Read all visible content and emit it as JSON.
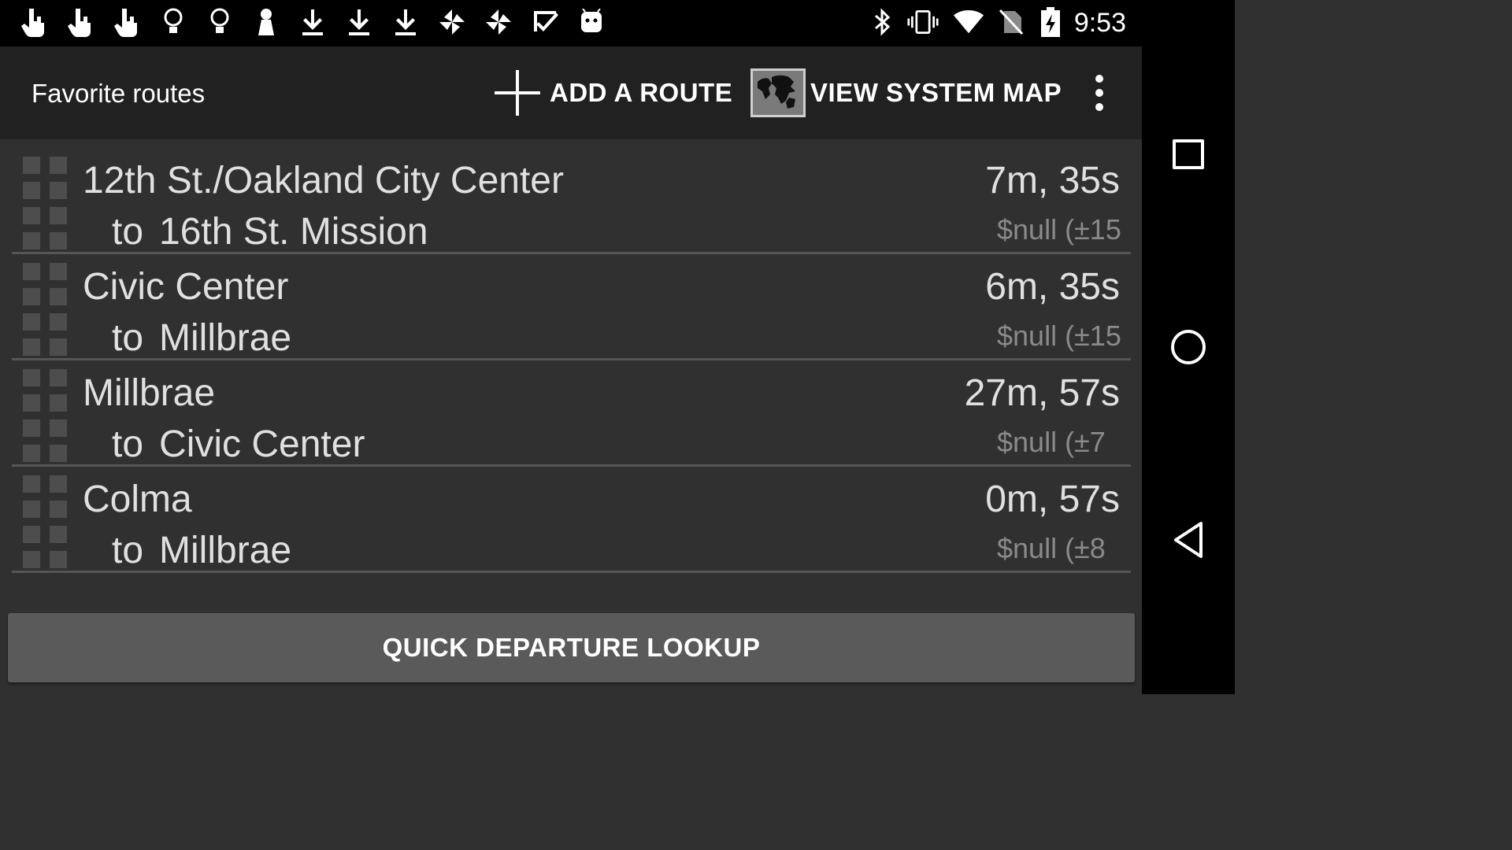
{
  "status_bar": {
    "notification_icons": [
      "hand-pointer-icon",
      "hand-pointer-icon",
      "hand-pointer-icon",
      "lightbulb-icon",
      "lightbulb-icon",
      "chess-pawn-icon",
      "download-icon",
      "download-icon",
      "download-icon",
      "pinwheel-icon",
      "pinwheel-icon",
      "checkmark-icon",
      "android-icon"
    ],
    "system_icons": [
      "bluetooth-icon",
      "vibrate-icon",
      "wifi-icon",
      "no-sim-icon",
      "battery-charging-icon"
    ],
    "time": "9:53"
  },
  "action_bar": {
    "title": "Favorite routes",
    "add_route_label": "ADD A ROUTE",
    "view_map_label": "VIEW SYSTEM MAP"
  },
  "routes": [
    {
      "from": "12th St./Oakland City Center",
      "to_word": "to",
      "to": "16th St. Mission",
      "time": "7m, 35s",
      "fare": "$null (±15"
    },
    {
      "from": "Civic Center",
      "to_word": "to",
      "to": "Millbrae",
      "time": "6m, 35s",
      "fare": "$null (±15"
    },
    {
      "from": "Millbrae",
      "to_word": "to",
      "to": "Civic Center",
      "time": "27m, 57s",
      "fare": "$null (±7"
    },
    {
      "from": "Colma",
      "to_word": "to",
      "to": "Millbrae",
      "time": "0m, 57s",
      "fare": "$null (±8"
    }
  ],
  "quick_lookup_label": "QUICK DEPARTURE LOOKUP",
  "colors": {
    "background": "#303030",
    "action_bar": "#212121",
    "button": "#5a5a5a",
    "fare_text": "#8a8a8a"
  }
}
